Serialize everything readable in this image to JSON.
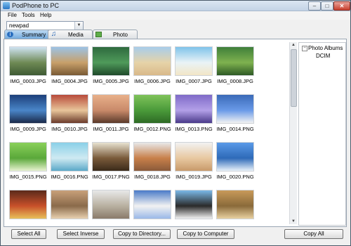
{
  "window": {
    "title": "PodPhone to PC"
  },
  "menu": [
    {
      "label": "File"
    },
    {
      "label": "Tools"
    },
    {
      "label": "Help"
    }
  ],
  "device": {
    "selected": "newpad"
  },
  "tabs": [
    {
      "label": "Summary",
      "active": true
    },
    {
      "label": "Media",
      "active": false
    },
    {
      "label": "Photo",
      "active": false
    }
  ],
  "photos": [
    {
      "name": "IMG_0003.JPG",
      "colors": [
        "#cfe3f2",
        "#6f8a55",
        "#3e5a33"
      ]
    },
    {
      "name": "IMG_0004.JPG",
      "colors": [
        "#9cc3e6",
        "#c8a06a",
        "#7a5a35"
      ]
    },
    {
      "name": "IMG_0005.JPG",
      "colors": [
        "#2e6a3e",
        "#4f9a5a",
        "#1f4a2a"
      ]
    },
    {
      "name": "IMG_0006.JPG",
      "colors": [
        "#a8cdea",
        "#e6d3a8",
        "#d9b98a"
      ]
    },
    {
      "name": "IMG_0007.JPG",
      "colors": [
        "#7fc3ea",
        "#e9f3f6",
        "#f2e6c6"
      ]
    },
    {
      "name": "IMG_0008.JPG",
      "colors": [
        "#3f7f3a",
        "#7fb24f",
        "#2e5a25"
      ]
    },
    {
      "name": "IMG_0009.JPG",
      "colors": [
        "#1c3f7a",
        "#4a86c8",
        "#1a2a4a"
      ]
    },
    {
      "name": "IMG_0010.JPG",
      "colors": [
        "#b84a3a",
        "#e8c59a",
        "#6a3a2a"
      ]
    },
    {
      "name": "IMG_0011.JPG",
      "colors": [
        "#e8b08a",
        "#c98a6a",
        "#5a3a2a"
      ]
    },
    {
      "name": "IMG_0012.PNG",
      "colors": [
        "#7fc35a",
        "#4a9a3a",
        "#2e6a25"
      ]
    },
    {
      "name": "IMG_0013.PNG",
      "colors": [
        "#7f6ac8",
        "#b3a0e8",
        "#4a3a8a"
      ]
    },
    {
      "name": "IMG_0014.PNG",
      "colors": [
        "#3a6ab8",
        "#6a9ae8",
        "#f2f2f2"
      ]
    },
    {
      "name": "IMG_0015.PNG",
      "colors": [
        "#8ad05a",
        "#5aa83a",
        "#e8f2d0"
      ]
    },
    {
      "name": "IMG_0016.PNG",
      "colors": [
        "#8ad0e8",
        "#cfeaf2",
        "#5aa8c8"
      ]
    },
    {
      "name": "IMG_0017.PNG",
      "colors": [
        "#e8e2d0",
        "#7a5a3a",
        "#3a2a1a"
      ]
    },
    {
      "name": "IMG_0018.JPG",
      "colors": [
        "#e8e8e8",
        "#c8804a",
        "#8a5a3a"
      ]
    },
    {
      "name": "IMG_0019.JPG",
      "colors": [
        "#f2f2f2",
        "#e8c8a0",
        "#c89a6a"
      ]
    },
    {
      "name": "IMG_0020.PNG",
      "colors": [
        "#5a9ae8",
        "#2e6ab8",
        "#e8f2fa"
      ]
    },
    {
      "name": "",
      "colors": [
        "#5a2a1a",
        "#c8502a",
        "#e8c05a"
      ]
    },
    {
      "name": "",
      "colors": [
        "#c8a07a",
        "#8a6a4a",
        "#e8d0b0"
      ]
    },
    {
      "name": "",
      "colors": [
        "#e8e8e8",
        "#b8b0a0",
        "#8a7a6a"
      ]
    },
    {
      "name": "",
      "colors": [
        "#4a7ac8",
        "#f2f2f2",
        "#9ab8e8"
      ]
    },
    {
      "name": "",
      "colors": [
        "#7ab8e8",
        "#2a2a2a",
        "#f2f2f2"
      ]
    },
    {
      "name": "",
      "colors": [
        "#c89a5a",
        "#8a6a3a",
        "#e8d0a0"
      ]
    }
  ],
  "album_tree": {
    "root": "Photo Albums",
    "child": "DCIM"
  },
  "buttons": {
    "select_all": "Select All",
    "select_inverse": "Select Inverse",
    "copy_to_directory": "Copy to Directory...",
    "copy_to_computer": "Copy to Computer",
    "copy_all": "Copy  All"
  }
}
